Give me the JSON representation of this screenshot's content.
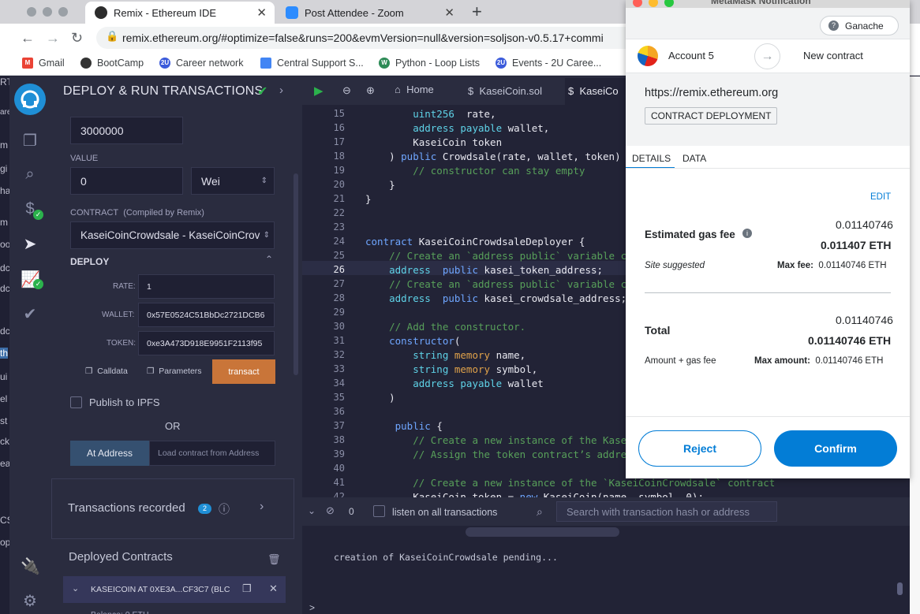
{
  "browser": {
    "tabs": [
      {
        "title": "Remix - Ethereum IDE",
        "active": true
      },
      {
        "title": "Post Attendee - Zoom",
        "active": false
      }
    ],
    "url": "remix.ethereum.org/#optimize=false&runs=200&evmVersion=null&version=soljson-v0.5.17+commi",
    "bookmarks": [
      "Gmail",
      "BootCamp",
      "Career network",
      "Central Support S...",
      "Python - Loop Lists",
      "Events - 2U Caree..."
    ]
  },
  "left_edge_fragments": [
    "RT",
    "are",
    "m",
    "gi",
    "ha",
    "m",
    "oo",
    "dc",
    "dc",
    "dc",
    "th",
    "ui",
    "el",
    "st",
    "ck",
    "ea",
    "CS",
    "op"
  ],
  "deploy_panel": {
    "title": "DEPLOY & RUN TRANSACTIONS",
    "gas_limit": "3000000",
    "value_label": "VALUE",
    "value": "0",
    "value_unit": "Wei",
    "contract_label": "CONTRACT",
    "compiled_label": "(Compiled by Remix)",
    "contract_selected": "KaseiCoinCrowdsale - KaseiCoinCrov",
    "deploy_label": "DEPLOY",
    "rate_label": "RATE:",
    "rate_value": "1",
    "wallet_label": "WALLET:",
    "wallet_value": "0x57E0524C51BbDc2721DCB6",
    "token_label": "TOKEN:",
    "token_value": "0xe3A473D918E9951F2113f95",
    "calldata_label": "Calldata",
    "parameters_label": "Parameters",
    "transact_label": "transact",
    "publish_label": "Publish to IPFS",
    "or_label": "OR",
    "at_address_label": "At Address",
    "load_contract_placeholder": "Load contract from Address",
    "transactions_recorded_label": "Transactions recorded",
    "transactions_count": "2",
    "deployed_contracts_label": "Deployed Contracts",
    "deployed_item": "KASEICOIN AT 0XE3A...CF3C7 (BLC",
    "deployed_item_partial_line": "Balance: 0 ETH"
  },
  "editor": {
    "tabs": [
      "Home",
      "KaseiCoin.sol",
      "KaseiCo"
    ],
    "active_line": 26,
    "lines": [
      {
        "n": 15,
        "segs": [
          [
            "ty",
            "        uint256"
          ],
          [
            "",
            "  rate,"
          ]
        ]
      },
      {
        "n": 16,
        "segs": [
          [
            "ty",
            "        address payable"
          ],
          [
            "",
            " wallet,"
          ]
        ]
      },
      {
        "n": 17,
        "segs": [
          [
            "",
            "        KaseiCoin token"
          ]
        ]
      },
      {
        "n": 18,
        "segs": [
          [
            "",
            "    ) "
          ],
          [
            "kw",
            "public"
          ],
          [
            "",
            " Crowdsale(rate, wallet, token) {"
          ]
        ]
      },
      {
        "n": 19,
        "segs": [
          [
            "cm",
            "        // constructor can stay empty"
          ]
        ]
      },
      {
        "n": 20,
        "segs": [
          [
            "",
            "    }"
          ]
        ]
      },
      {
        "n": 21,
        "segs": [
          [
            "",
            "}"
          ]
        ]
      },
      {
        "n": 22,
        "segs": [
          [
            "",
            ""
          ]
        ]
      },
      {
        "n": 23,
        "segs": [
          [
            "",
            ""
          ]
        ]
      },
      {
        "n": 24,
        "segs": [
          [
            "kw",
            "contract"
          ],
          [
            "",
            " KaseiCoinCrowdsaleDeployer {"
          ]
        ]
      },
      {
        "n": 25,
        "segs": [
          [
            "cm",
            "    // Create an `address public` variable cal"
          ]
        ]
      },
      {
        "n": 26,
        "segs": [
          [
            "ty",
            "    address"
          ],
          [
            "kw",
            "  public"
          ],
          [
            "",
            " kasei_token_address;"
          ]
        ]
      },
      {
        "n": 27,
        "segs": [
          [
            "cm",
            "    // Create an `address public` variable cal"
          ]
        ]
      },
      {
        "n": 28,
        "segs": [
          [
            "ty",
            "    address"
          ],
          [
            "kw",
            "  public"
          ],
          [
            "",
            " kasei_crowdsale_address;"
          ]
        ]
      },
      {
        "n": 29,
        "segs": [
          [
            "",
            ""
          ]
        ]
      },
      {
        "n": 30,
        "segs": [
          [
            "cm",
            "    // Add the constructor."
          ]
        ]
      },
      {
        "n": 31,
        "segs": [
          [
            "kw",
            "    constructor"
          ],
          [
            "",
            "("
          ]
        ]
      },
      {
        "n": 32,
        "segs": [
          [
            "ty",
            "        string"
          ],
          [
            "mem",
            " memory"
          ],
          [
            "",
            " name,"
          ]
        ]
      },
      {
        "n": 33,
        "segs": [
          [
            "ty",
            "        string"
          ],
          [
            "mem",
            " memory"
          ],
          [
            "",
            " symbol,"
          ]
        ]
      },
      {
        "n": 34,
        "segs": [
          [
            "ty",
            "        address payable"
          ],
          [
            "",
            " wallet"
          ]
        ]
      },
      {
        "n": 35,
        "segs": [
          [
            "",
            "    )"
          ]
        ]
      },
      {
        "n": 36,
        "segs": [
          [
            "",
            ""
          ]
        ]
      },
      {
        "n": 37,
        "segs": [
          [
            "kw",
            "     public"
          ],
          [
            "",
            " {"
          ]
        ]
      },
      {
        "n": 38,
        "segs": [
          [
            "cm",
            "        // Create a new instance of the KaseiC"
          ]
        ]
      },
      {
        "n": 39,
        "segs": [
          [
            "cm",
            "        // Assign the token contract’s address"
          ]
        ]
      },
      {
        "n": 40,
        "segs": [
          [
            "",
            ""
          ]
        ]
      },
      {
        "n": 41,
        "segs": [
          [
            "cm",
            "        // Create a new instance of the `KaseiCoinCrowdsale` contract"
          ]
        ]
      },
      {
        "n": 42,
        "segs": [
          [
            "",
            "        KaseiCoin token = "
          ],
          [
            "kw",
            "new"
          ],
          [
            "",
            " KaseiCoin(name, symbol, 0);"
          ]
        ]
      }
    ]
  },
  "terminal": {
    "count": "0",
    "listen_label": "listen on all transactions",
    "search_placeholder": "Search with transaction hash or address",
    "log": "creation of KaseiCoinCrowdsale pending...",
    "prompt": ">"
  },
  "metamask": {
    "title": "MetaMask Notification",
    "network": "Ganache",
    "account": "Account 5",
    "target": "New contract",
    "origin": "https://remix.ethereum.org",
    "badge": "CONTRACT DEPLOYMENT",
    "tab_details": "DETAILS",
    "tab_data": "DATA",
    "edit": "EDIT",
    "gas_fee_label": "Estimated gas fee",
    "gas_fee_small": "0.01140746",
    "gas_fee_big": "0.011407 ETH",
    "site_suggested": "Site suggested",
    "max_fee_label": "Max fee:",
    "max_fee_value": "0.01140746 ETH",
    "total_label": "Total",
    "total_small": "0.01140746",
    "total_big": "0.01140746 ETH",
    "amount_gas_label": "Amount + gas fee",
    "max_amount_label": "Max amount:",
    "max_amount_value": "0.01140746 ETH",
    "reject": "Reject",
    "confirm": "Confirm"
  },
  "colors": {
    "remix_bg": "#222336",
    "remix_panel": "#2a2c3f",
    "transact": "#c97539",
    "mm_blue": "#037dd6"
  }
}
